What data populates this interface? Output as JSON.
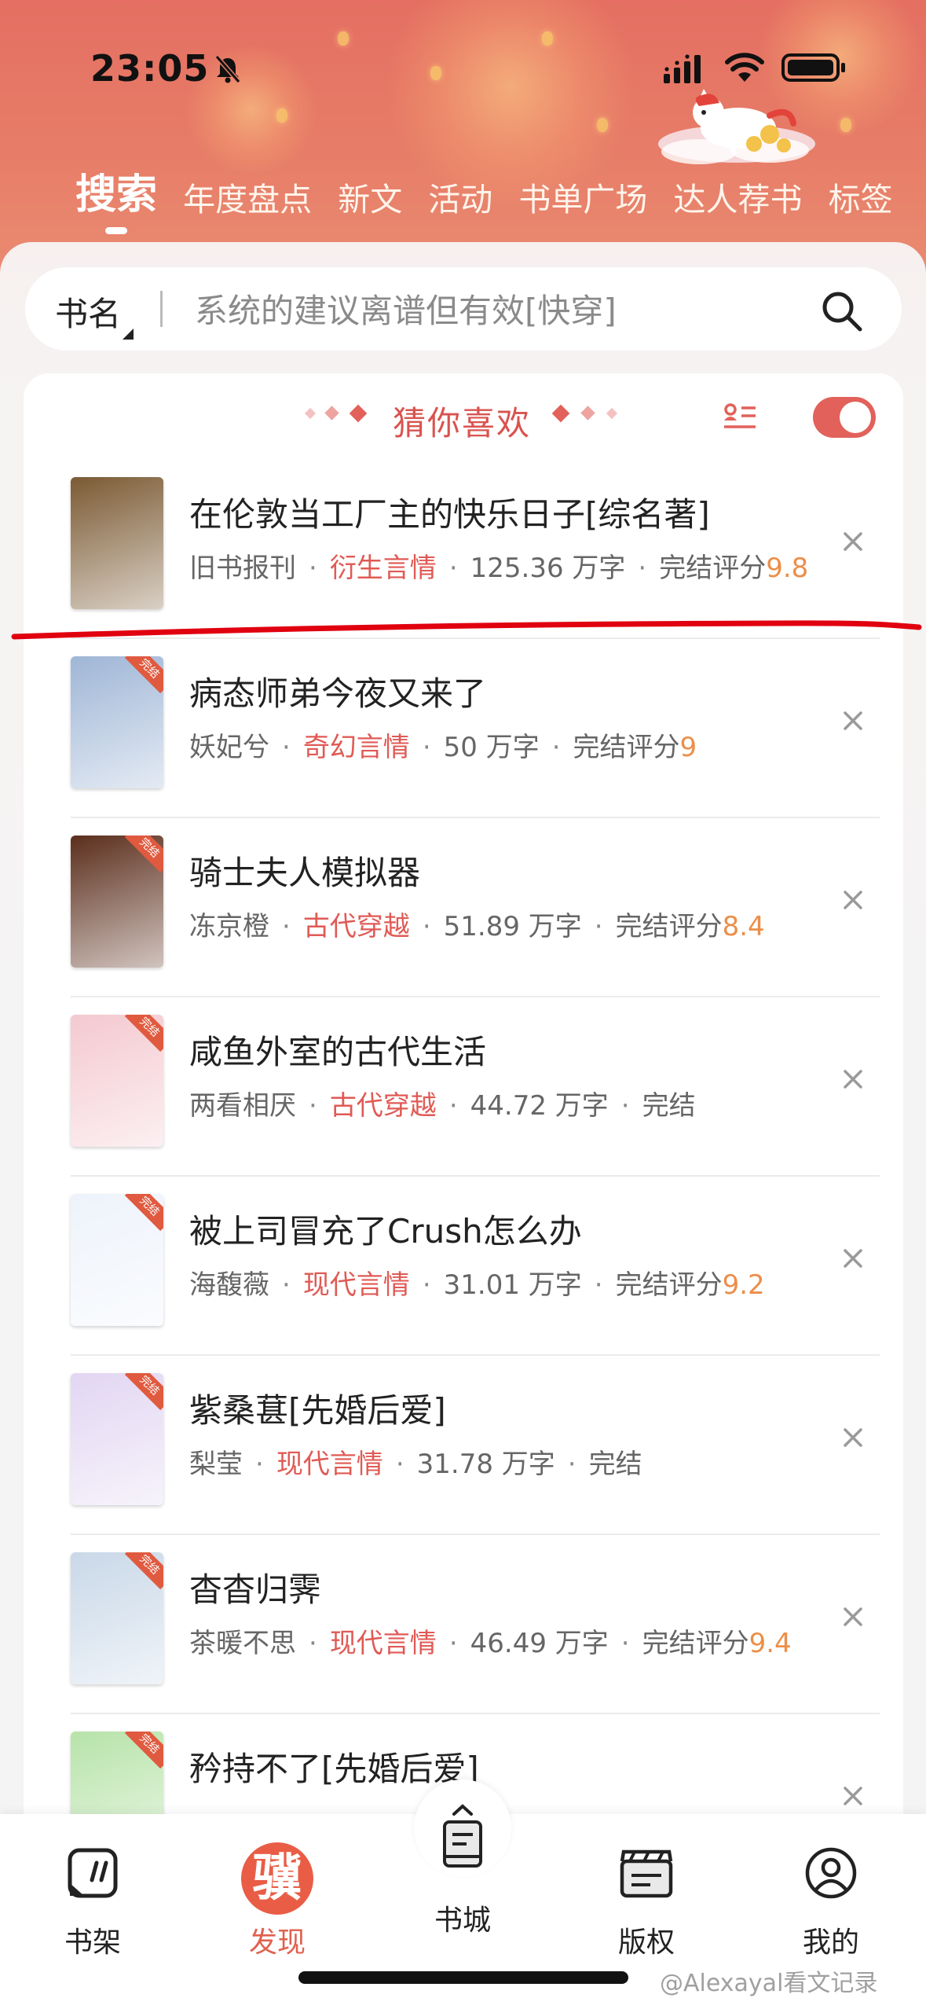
{
  "status_bar": {
    "time": "23:05"
  },
  "tabs": [
    {
      "label": "搜索",
      "active": true
    },
    {
      "label": "年度盘点"
    },
    {
      "label": "新文"
    },
    {
      "label": "活动"
    },
    {
      "label": "书单广场"
    },
    {
      "label": "达人荐书"
    },
    {
      "label": "标签"
    }
  ],
  "search": {
    "type_label": "书名",
    "query": "系统的建议离谱但有效[快穿]"
  },
  "recommend": {
    "title": "猜你喜欢",
    "toggle_on": true,
    "books": [
      {
        "title": "在伦敦当工厂主的快乐日子[综名著]",
        "author": "旧书报刊",
        "genre": "衍生言情",
        "words": "125.36 万字",
        "status": "完结评分",
        "score": "9.8",
        "cover_color": "#7b5a33"
      },
      {
        "title": "病态师弟今夜又来了",
        "author": "妖妃兮",
        "genre": "奇幻言情",
        "words": "50 万字",
        "status": "完结评分",
        "score": "9",
        "cover_color": "#9fb6d6"
      },
      {
        "title": "骑士夫人模拟器",
        "author": "冻京橙",
        "genre": "古代穿越",
        "words": "51.89 万字",
        "status": "完结评分",
        "score": "8.4",
        "cover_color": "#5b2e1c"
      },
      {
        "title": "咸鱼外室的古代生活",
        "author": "两看相厌",
        "genre": "古代穿越",
        "words": "44.72 万字",
        "status": "完结",
        "score": "",
        "cover_color": "#f4c9d0"
      },
      {
        "title": "被上司冒充了Crush怎么办",
        "author": "海馥薇",
        "genre": "现代言情",
        "words": "31.01 万字",
        "status": "完结评分",
        "score": "9.2",
        "cover_color": "#eef3fb"
      },
      {
        "title": "紫桑葚[先婚后爱]",
        "author": "梨莹",
        "genre": "现代言情",
        "words": "31.78 万字",
        "status": "完结",
        "score": "",
        "cover_color": "#e2d6f2"
      },
      {
        "title": "杳杳归霁",
        "author": "茶暖不思",
        "genre": "现代言情",
        "words": "46.49 万字",
        "status": "完结评分",
        "score": "9.4",
        "cover_color": "#c9d8e8"
      },
      {
        "title": "矜持不了[先婚后爱]",
        "author": "",
        "genre": "",
        "words": "",
        "status": "",
        "score": "",
        "cover_color": "#b7e3a9"
      }
    ]
  },
  "cover_badge": "完结",
  "bottom_nav": [
    {
      "label": "书架",
      "icon": "bookshelf-icon"
    },
    {
      "label": "发现",
      "icon": "discover-icon",
      "active": true,
      "glyph": "骥"
    },
    {
      "label": "书城",
      "icon": "bookstore-icon"
    },
    {
      "label": "版权",
      "icon": "copyright-icon"
    },
    {
      "label": "我的",
      "icon": "profile-icon"
    }
  ],
  "watermark": "@Alexayal看文记录",
  "colors": {
    "header": "#e46f62",
    "accent": "#e05a55",
    "score": "#ec8e48",
    "annotation_line": "#e0000f"
  }
}
